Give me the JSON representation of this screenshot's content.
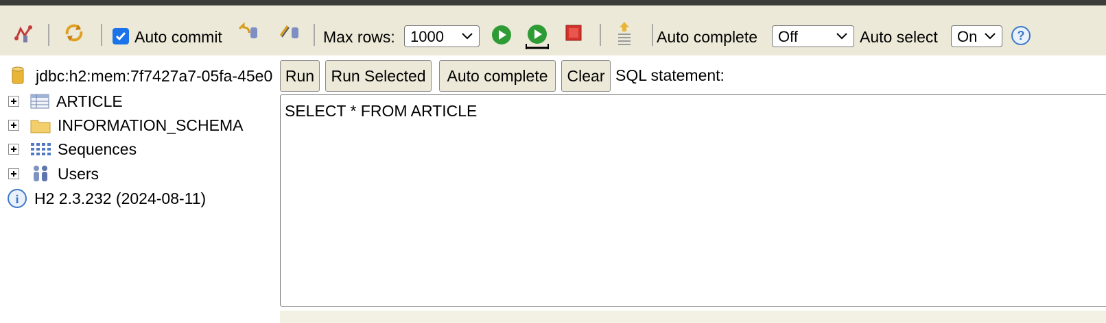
{
  "toolbar": {
    "auto_commit_label": "Auto commit",
    "auto_commit_checked": true,
    "max_rows_label": "Max rows:",
    "max_rows_value": "1000",
    "auto_complete_label": "Auto complete",
    "auto_complete_value": "Off",
    "auto_select_label": "Auto select",
    "auto_select_value": "On",
    "icons": [
      "disconnect-icon",
      "refresh-icon",
      "rollback-icon",
      "commit-icon",
      "run-icon",
      "run-selected-icon",
      "stop-icon",
      "history-icon",
      "help-icon"
    ]
  },
  "tree": {
    "connection": "jdbc:h2:mem:7f7427a7-05fa-45e0",
    "items": [
      {
        "label": "ARTICLE",
        "icon": "table-icon"
      },
      {
        "label": "INFORMATION_SCHEMA",
        "icon": "folder-icon"
      },
      {
        "label": "Sequences",
        "icon": "sequences-icon"
      },
      {
        "label": "Users",
        "icon": "users-icon"
      }
    ],
    "version": "H2 2.3.232 (2024-08-11)"
  },
  "editor": {
    "run_label": "Run",
    "run_selected_label": "Run Selected",
    "auto_complete_label": "Auto complete",
    "clear_label": "Clear",
    "sql_label": "SQL statement:",
    "sql_text": "SELECT * FROM ARTICLE"
  },
  "colors": {
    "toolbar_bg": "#ece9d8",
    "top_strip": "#3c3c3a",
    "accent_blue": "#1a73e8",
    "run_green": "#2e9b35",
    "stop_red": "#d6312b"
  }
}
